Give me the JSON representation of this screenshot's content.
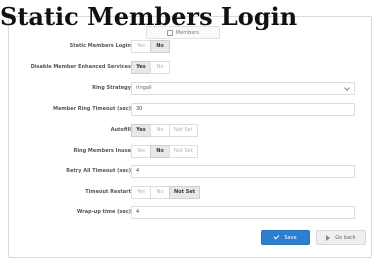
{
  "page": {
    "title": "Static Members Login"
  },
  "panel": {
    "tab_label": "Members"
  },
  "form": {
    "static_members_login": {
      "label": "Static Members Login",
      "options": [
        "Yes",
        "No"
      ],
      "selected": "No"
    },
    "disable_member_enhanced_services": {
      "label": "Disable Member Enhanced Services",
      "options": [
        "Yes",
        "No"
      ],
      "selected": "Yes"
    },
    "ring_strategy": {
      "label": "Ring Strategy",
      "value": "ringall"
    },
    "member_ring_timeout": {
      "label": "Member Ring Timeout (sec)",
      "value": "30"
    },
    "autofill": {
      "label": "Autofill",
      "options": [
        "Yes",
        "No",
        "Not Set"
      ],
      "selected": "Yes"
    },
    "ring_members_inuse": {
      "label": "Ring Members Inuse",
      "options": [
        "Yes",
        "No",
        "Not Set"
      ],
      "selected": "No"
    },
    "retry_all_timeout": {
      "label": "Retry All Timeout (sec)",
      "value": "4"
    },
    "timeout_restart": {
      "label": "Timeout Restart",
      "options": [
        "Yes",
        "No",
        "Not Set"
      ],
      "selected": "Not Set"
    },
    "wrap_up_time": {
      "label": "Wrap-up time (sec)",
      "value": "4"
    }
  },
  "actions": {
    "save_label": "Save",
    "back_label": "Go back"
  },
  "colors": {
    "save_button": "#2f7fd0",
    "active_segment": "#e8e8e8"
  }
}
